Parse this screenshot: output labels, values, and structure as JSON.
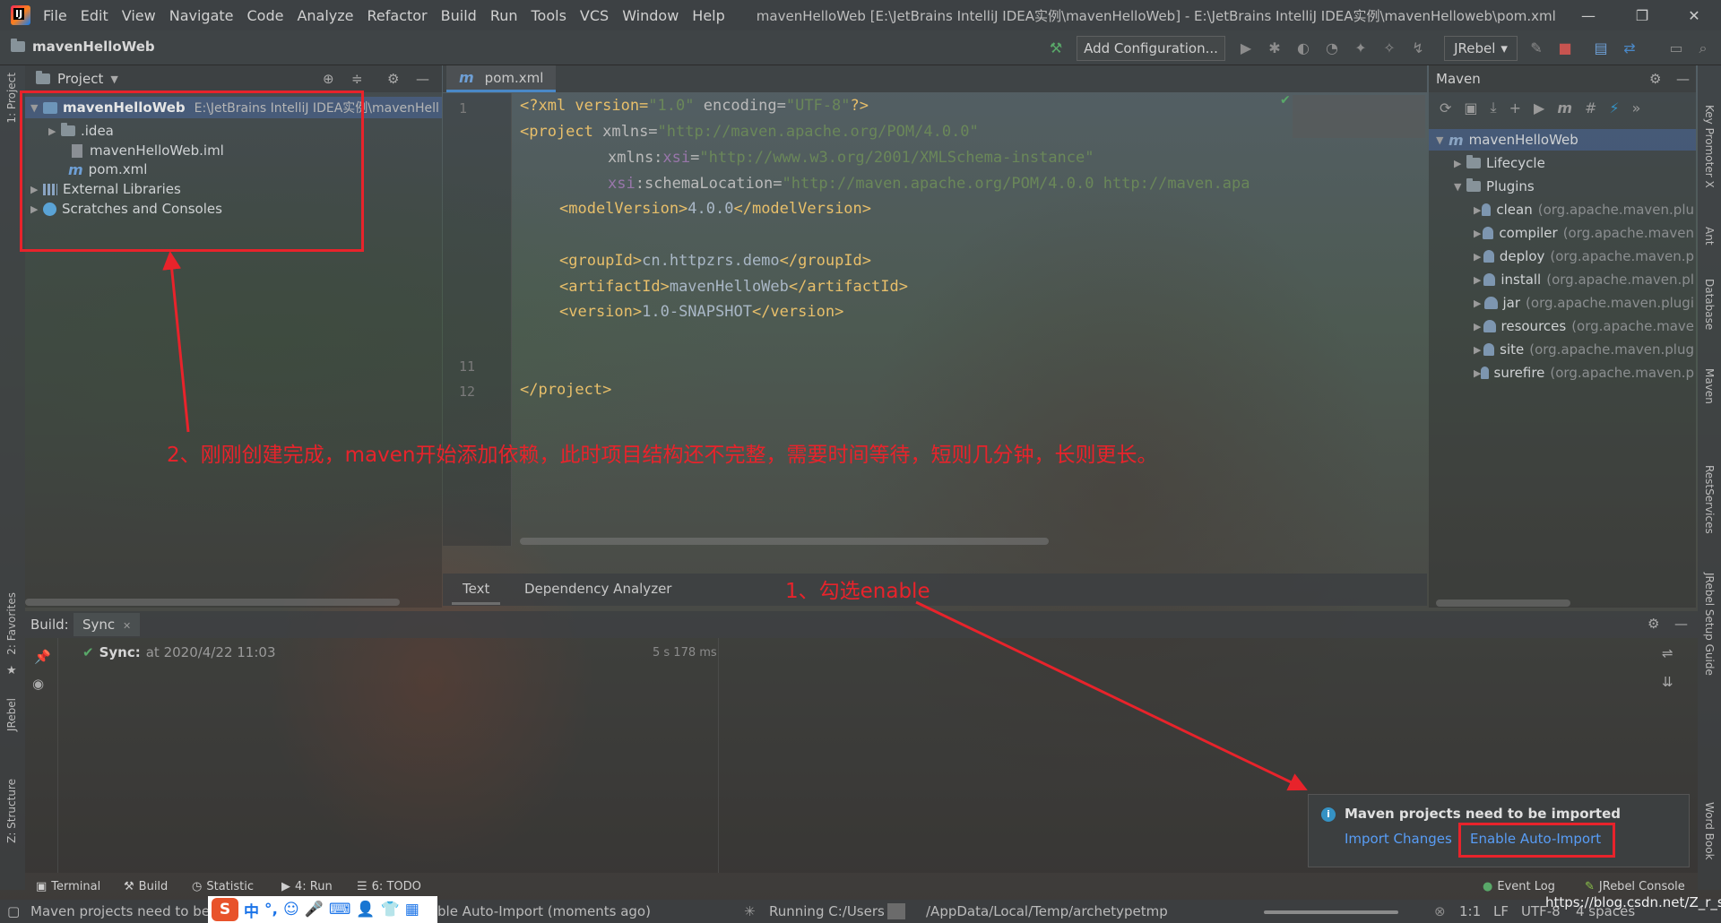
{
  "menubar": {
    "items": [
      "File",
      "Edit",
      "View",
      "Navigate",
      "Code",
      "Analyze",
      "Refactor",
      "Build",
      "Run",
      "Tools",
      "VCS",
      "Window",
      "Help"
    ],
    "title": "mavenHelloWeb [E:\\JetBrains IntelliJ IDEA实例\\mavenHelloWeb] - E:\\JetBrains IntelliJ IDEA实例\\mavenHelloweb\\pom.xml",
    "minimize": "—",
    "restore": "❐",
    "close": "✕"
  },
  "toolbar": {
    "breadcrumb": "mavenHelloWeb",
    "add_configuration": "Add Configuration...",
    "jrebel": "JRebel"
  },
  "left_stripe": {
    "project": "1: Project",
    "favorites": "2: Favorites",
    "jrebel": "JRebel",
    "structure": "Z: Structure"
  },
  "right_stripe": {
    "key_promoter": "Key Promoter X",
    "ant": "Ant",
    "database": "Database",
    "maven": "Maven",
    "rest": "RestServices",
    "jrebel_guide": "JRebel Setup Guide",
    "word_book": "Word Book"
  },
  "project_panel": {
    "title": "Project",
    "root_name": "mavenHelloWeb",
    "root_path": "E:\\JetBrains IntelliJ IDEA实例\\mavenHell",
    "items": [
      ".idea",
      "mavenHelloWeb.iml",
      "pom.xml"
    ],
    "external_libraries": "External Libraries",
    "scratches": "Scratches and Consoles"
  },
  "editor": {
    "tab": "pom.xml",
    "line_numbers": [
      "1",
      "11",
      "12"
    ],
    "code": {
      "l1_decl": "<?xml version=",
      "l1_v": "\"1.0\"",
      "l1_enc": " encoding=",
      "l1_ev": "\"UTF-8\"",
      "l1_end": "?>",
      "l2_tag": "<project",
      "l2_attr": " xmlns=",
      "l2_val": "\"http://maven.apache.org/POM/4.0.0\"",
      "l3_attr": "xmlns:",
      "l3_ns": "xsi",
      "l3_eq": "=",
      "l3_val": "\"http://www.w3.org/2001/XMLSchema-instance\"",
      "l4_ns": "xsi",
      "l4_attr": ":schemaLocation=",
      "l4_val": "\"http://maven.apache.org/POM/4.0.0 http://maven.apa",
      "model_open": "<modelVersion>",
      "model_val": "4.0.0",
      "model_close": "</modelVersion>",
      "group_open": "<groupId>",
      "group_val": "cn.httpzrs.demo",
      "group_close": "</groupId>",
      "artifact_open": "<artifactId>",
      "artifact_val": "mavenHelloWeb",
      "artifact_close": "</artifactId>",
      "version_open": "<version>",
      "version_val": "1.0-SNAPSHOT",
      "version_close": "</version>",
      "project_close": "</project>"
    },
    "bottom_tabs": [
      "Text",
      "Dependency Analyzer"
    ]
  },
  "maven_panel": {
    "title": "Maven",
    "root": "mavenHelloWeb",
    "lifecycle": "Lifecycle",
    "plugins": "Plugins",
    "plugin_items": [
      {
        "name": "clean",
        "group": "(org.apache.maven.plu"
      },
      {
        "name": "compiler",
        "group": "(org.apache.maven"
      },
      {
        "name": "deploy",
        "group": "(org.apache.maven.p"
      },
      {
        "name": "install",
        "group": "(org.apache.maven.pl"
      },
      {
        "name": "jar",
        "group": "(org.apache.maven.plugi"
      },
      {
        "name": "resources",
        "group": "(org.apache.mave"
      },
      {
        "name": "site",
        "group": "(org.apache.maven.plug"
      },
      {
        "name": "surefire",
        "group": "(org.apache.maven.p"
      }
    ]
  },
  "build_panel": {
    "label": "Build:",
    "tab": "Sync",
    "sync_label": "Sync:",
    "sync_time": "at 2020/4/22 11:03",
    "duration": "5 s 178 ms"
  },
  "notification": {
    "title": "Maven projects need to be imported",
    "import_changes": "Import Changes",
    "enable_auto_import": "Enable Auto-Import"
  },
  "tool_tabs": [
    "Terminal",
    "Build",
    "Statistic",
    "4: Run",
    "6: TODO"
  ],
  "tool_tabs_right": [
    "Event Log",
    "JRebel Console"
  ],
  "statusbar": {
    "message_left": "Maven projects need to be",
    "message_right": "ble Auto-Import (moments ago)",
    "running": "Running C:/Users",
    "running_path": "/AppData/Local/Temp/archetypetmp",
    "position": "1:1",
    "line_sep": "LF",
    "encoding": "UTF-8",
    "indent": "4 spaces",
    "watermark": "https://blog.csdn.net/Z_r_s"
  },
  "ime": {
    "logo": "S",
    "chars": [
      "中",
      "°,",
      "☺",
      "🎤",
      "⌨",
      "👤",
      "👕",
      "▦"
    ]
  },
  "annotations": {
    "step1": "1、勾选enable",
    "step2": "2、刚刚创建完成，maven开始添加依赖，此时项目结构还不完整，需要时间等待，短则几分钟，长则更长。"
  },
  "colors": {
    "annotation_red": "#e8232b",
    "link_blue": "#589df6",
    "xml_tag": "#e8bf6a",
    "xml_string": "#6a8759"
  }
}
